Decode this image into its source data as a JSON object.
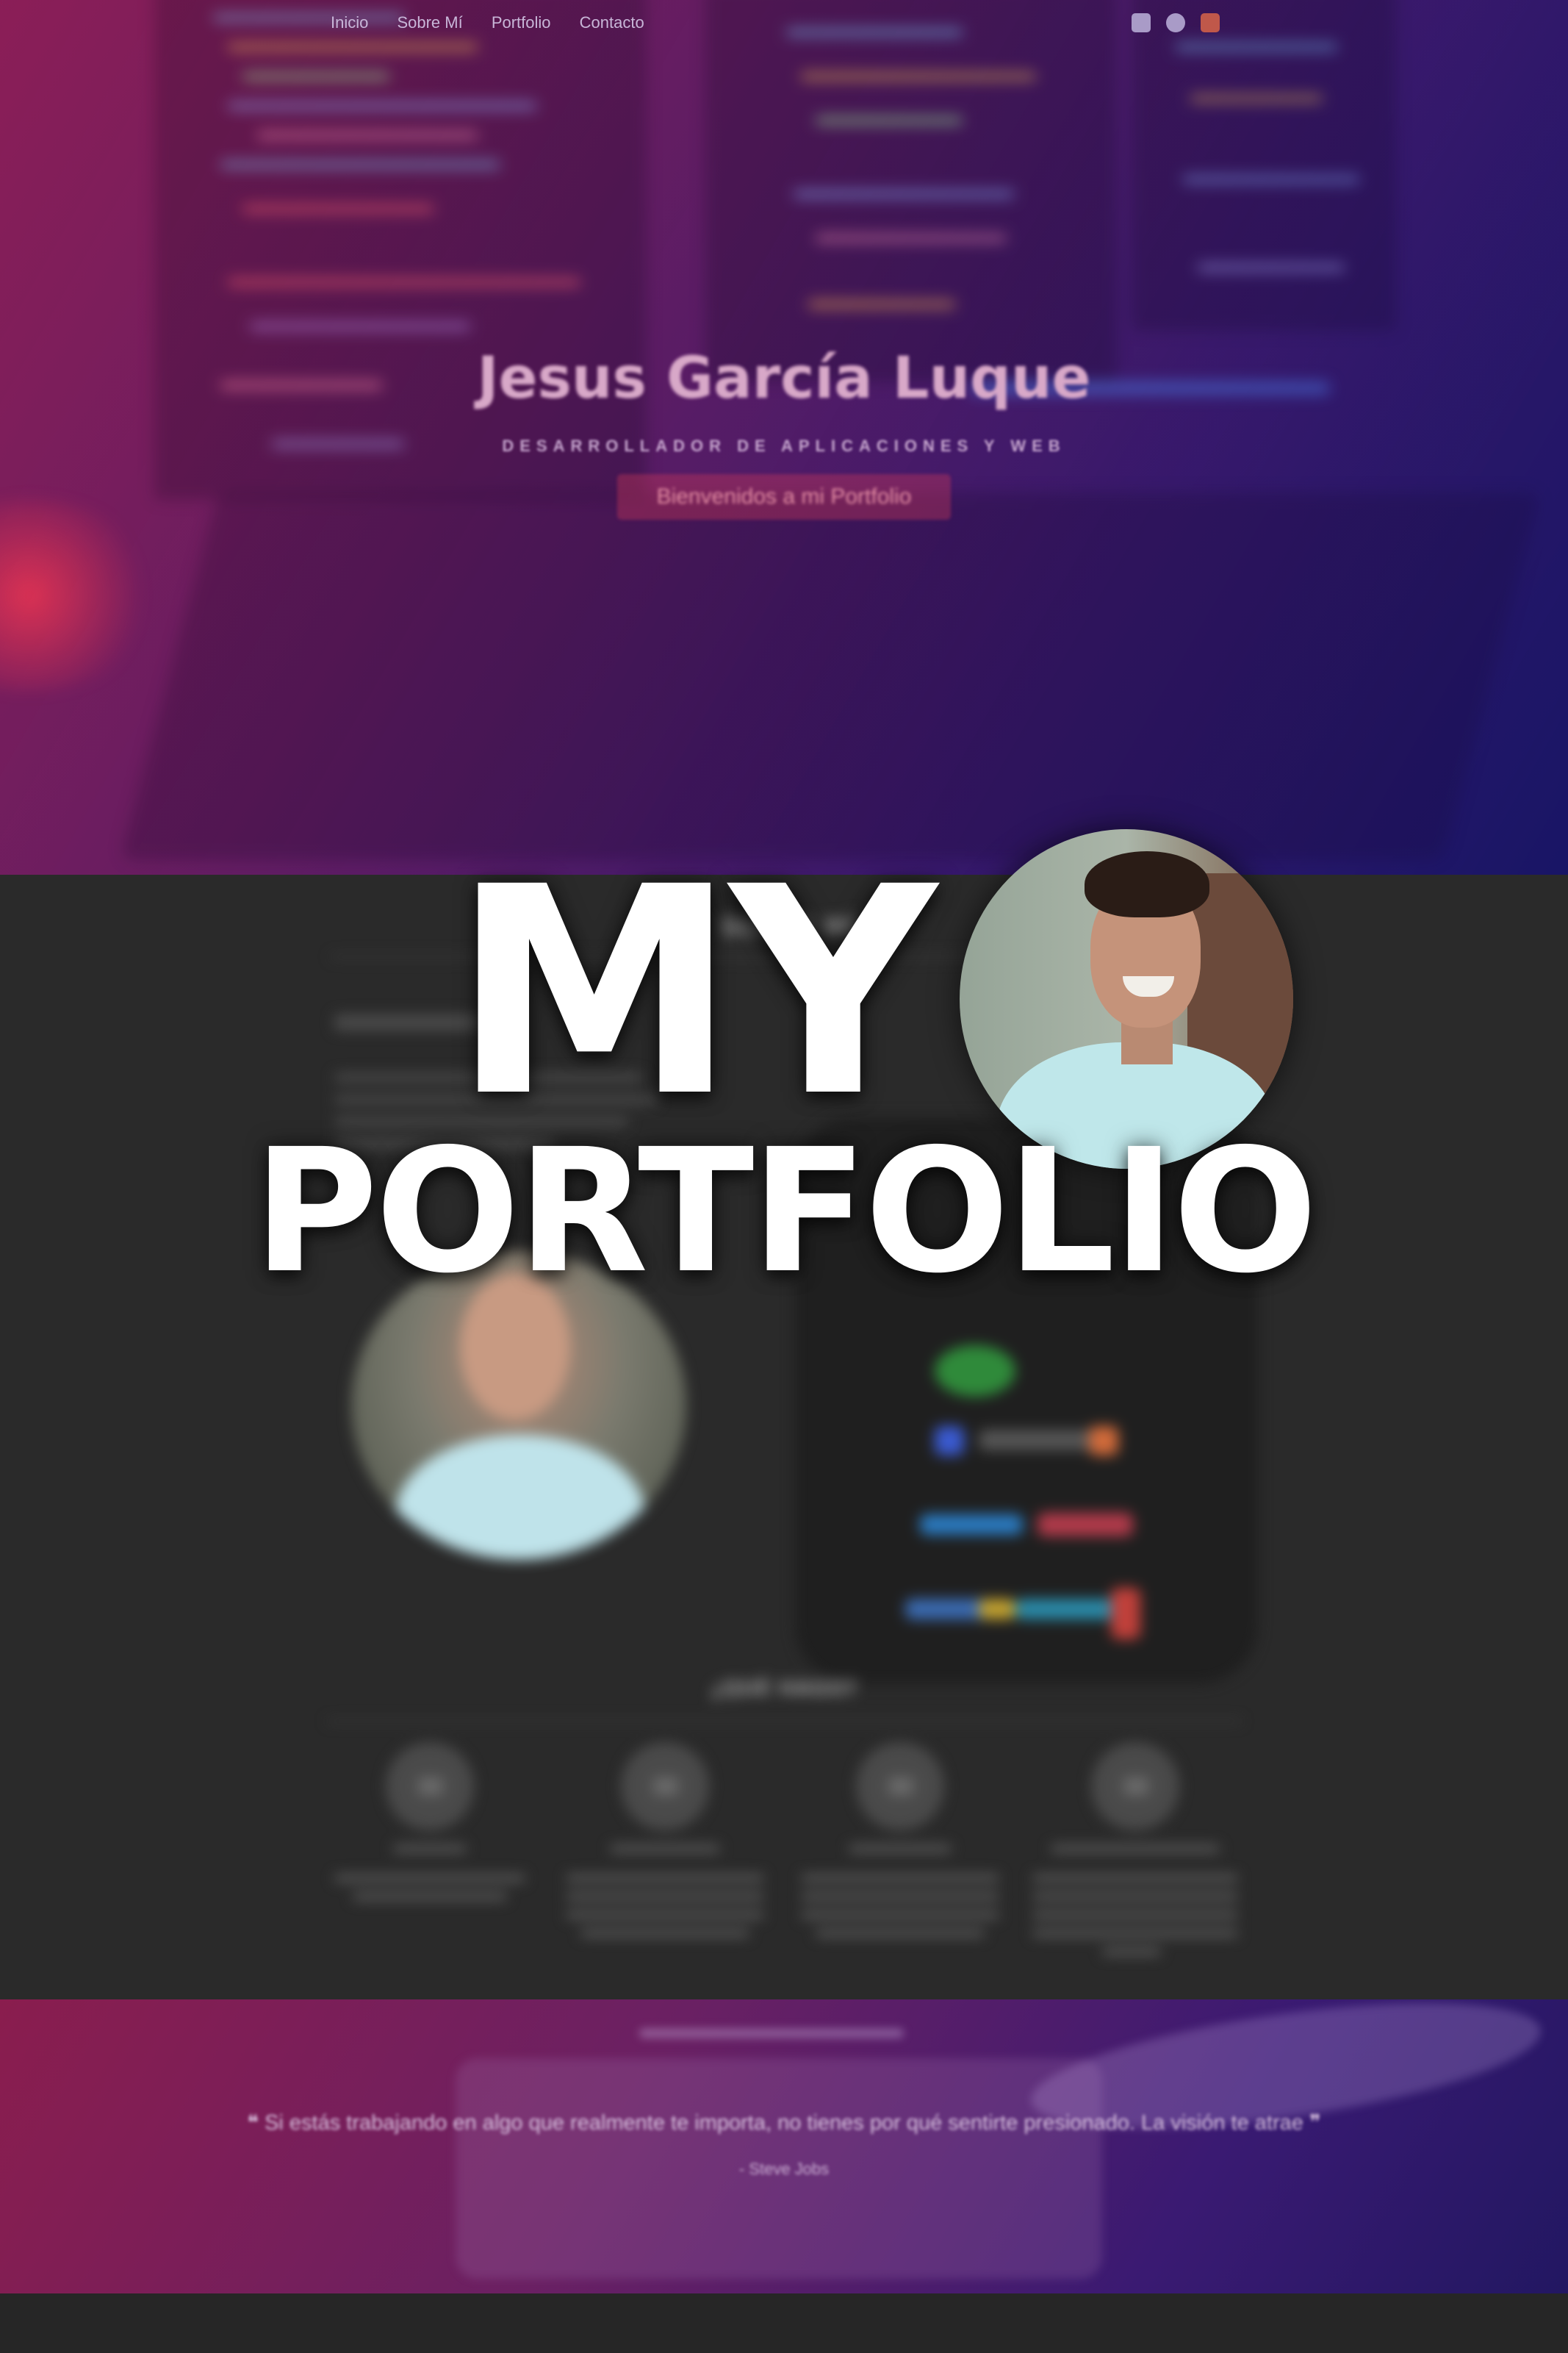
{
  "hero": {
    "nav_items": [
      "Inicio",
      "Sobre Mí",
      "Portfolio",
      "Contacto"
    ],
    "name": "Jesus García Luque",
    "role": "DESARROLLADOR DE APLICACIONES Y WEB",
    "cta": "Bienvenidos a mi Portfolio"
  },
  "about": {
    "title": "SOBRE MÍ",
    "what_title": "¿QUÉ HAGO?"
  },
  "quote": {
    "text": "❝ Si estás trabajando en algo que realmente te importa, no tienes por qué sentirte presionado. La visión te atrae ❞",
    "author": "- Steve Jobs"
  },
  "overlay": {
    "line1": "MY",
    "line2": "PORTFOLIO"
  },
  "colors": {
    "hero_gradient_start": "#7a1f5a",
    "hero_gradient_end": "#1d1760",
    "dark_section": "#2a2a2a",
    "title_text": "#ffffff"
  }
}
